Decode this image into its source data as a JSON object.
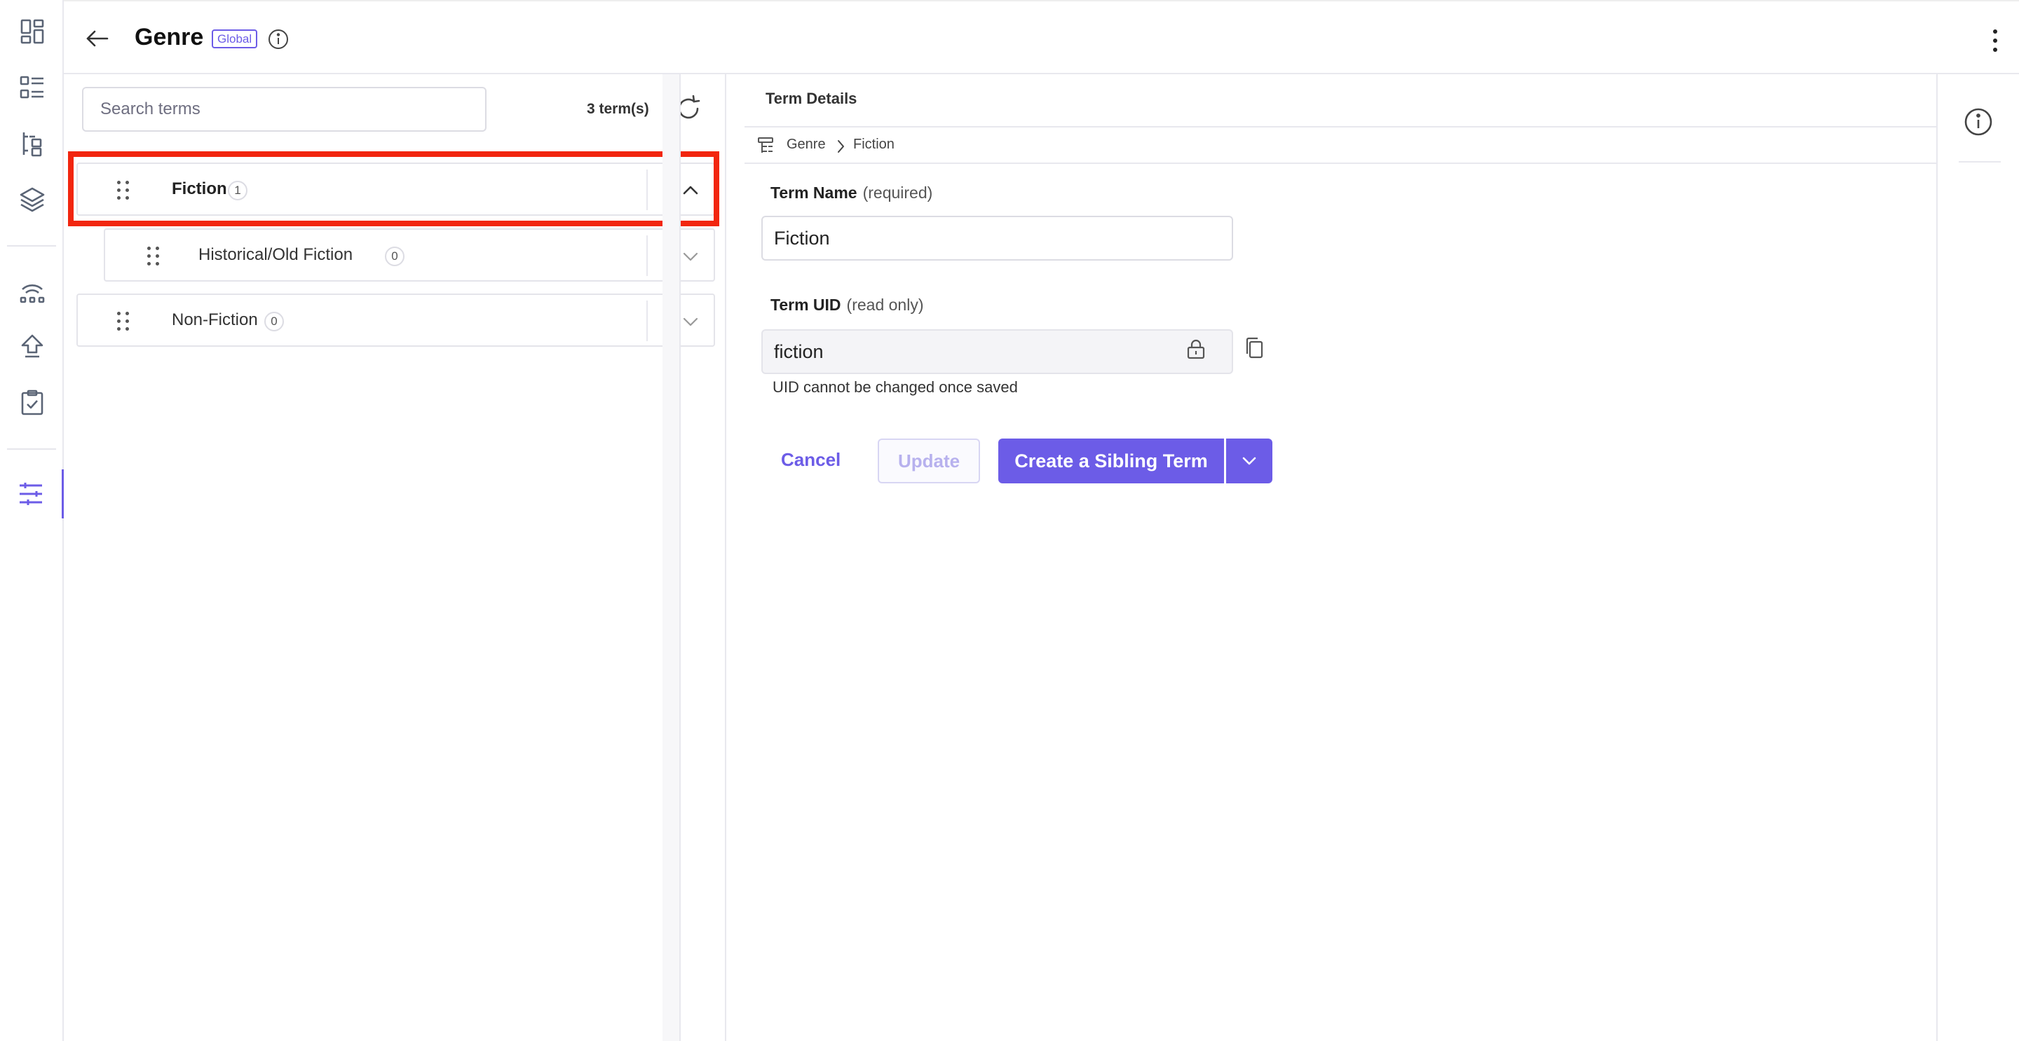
{
  "header": {
    "title": "Genre",
    "scope_badge": "Global"
  },
  "rail": {
    "icons": [
      "dashboard-icon",
      "entries-icon",
      "taxonomy-tree-icon",
      "stack-icon",
      "releases-icon",
      "upload-icon",
      "tasks-icon",
      "settings-sliders-icon"
    ],
    "active_color": "#6c5ce7"
  },
  "terms": {
    "search_placeholder": "Search terms",
    "count_label": "3 term(s)",
    "items": [
      {
        "label": "Fiction",
        "count": "1",
        "expanded": true
      },
      {
        "label": "Historical/Old Fiction",
        "count": "0",
        "expanded": false
      },
      {
        "label": "Non-Fiction",
        "count": "0",
        "expanded": false
      }
    ]
  },
  "details": {
    "title": "Term Details",
    "breadcrumb": {
      "root": "Genre",
      "current": "Fiction"
    },
    "term_name": {
      "label": "Term Name",
      "hint": "(required)",
      "value": "Fiction"
    },
    "term_uid": {
      "label": "Term UID",
      "hint": "(read only)",
      "value": "fiction",
      "helper": "UID cannot be changed once saved"
    },
    "buttons": {
      "cancel": "Cancel",
      "update": "Update",
      "create_sibling": "Create a Sibling Term"
    }
  },
  "colors": {
    "accent": "#6c5ce7",
    "highlight": "#f2260f"
  }
}
